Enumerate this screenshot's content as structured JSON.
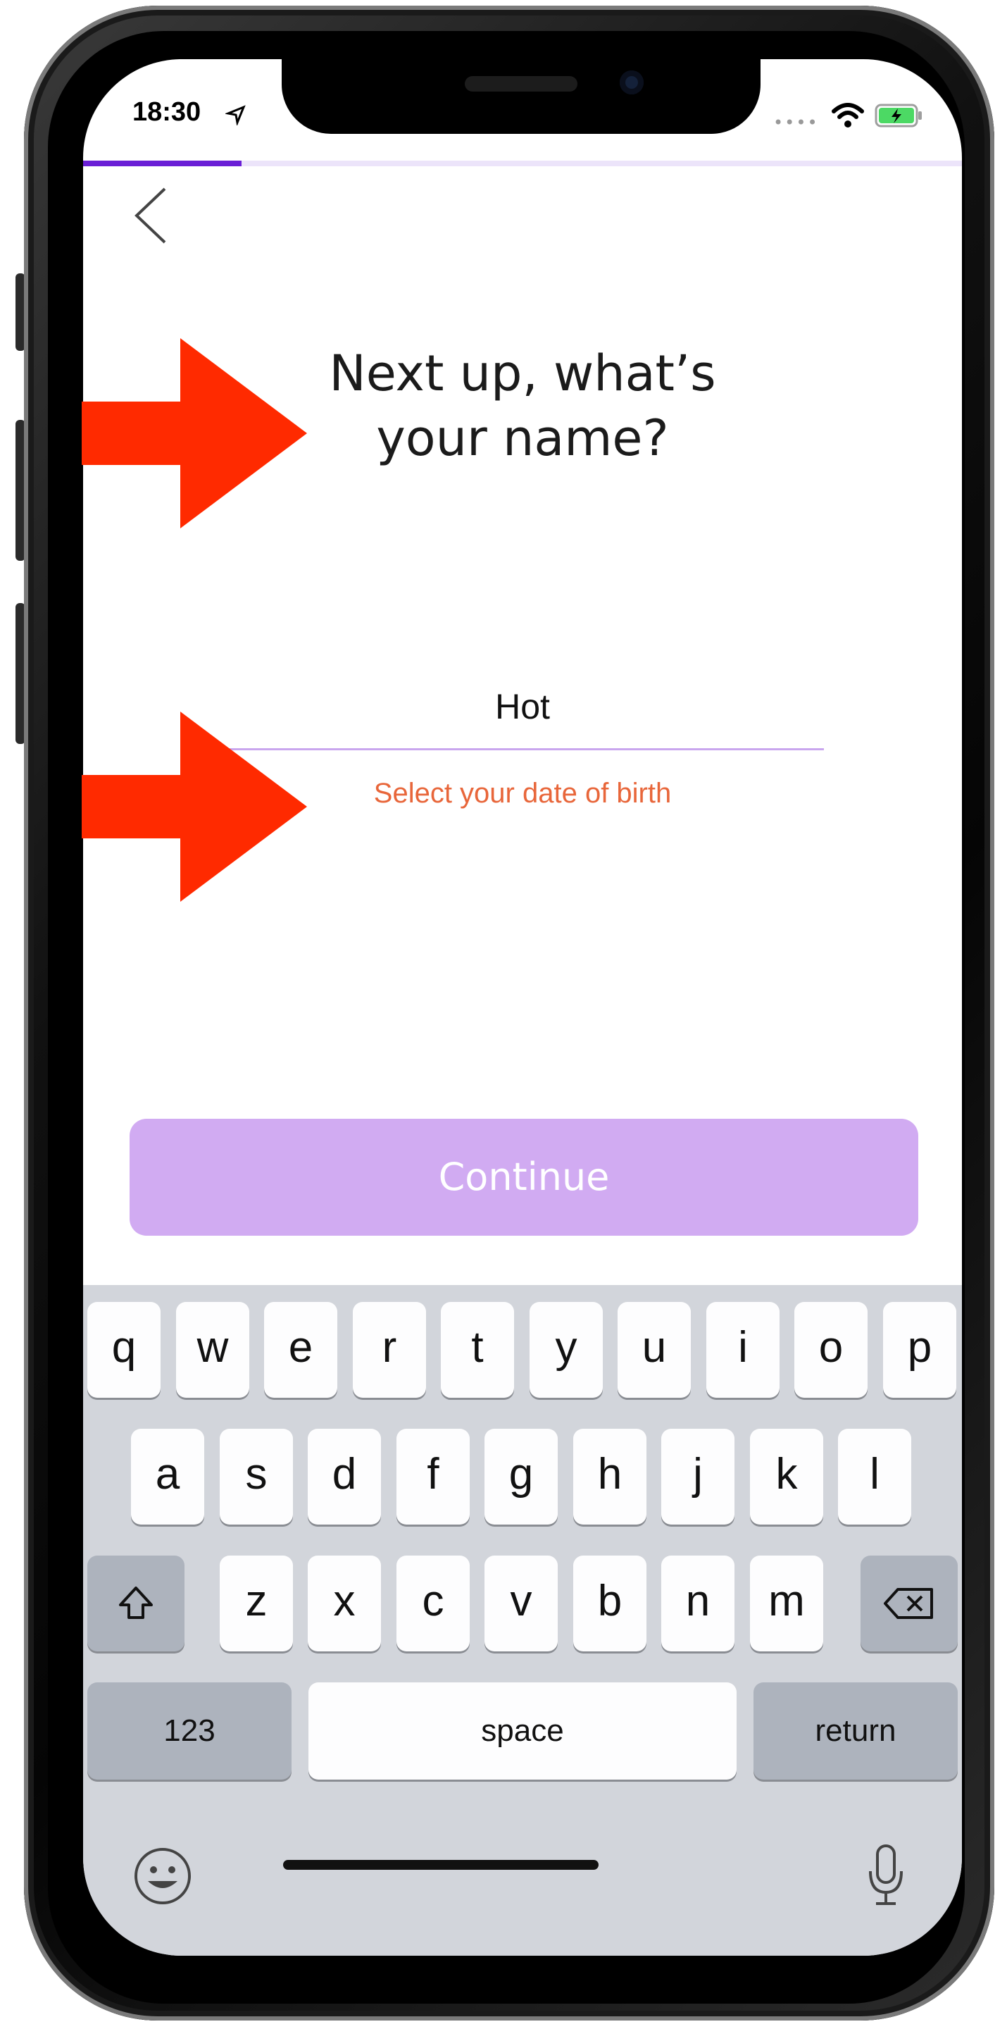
{
  "status_bar": {
    "time": "18:30"
  },
  "onboarding": {
    "progress": 0.18,
    "heading_line1": "Next up, what’s",
    "heading_line2": "your name?",
    "name_value": "Hot",
    "error_message": "Select your date of birth",
    "continue_label": "Continue"
  },
  "keyboard": {
    "row1": [
      "q",
      "w",
      "e",
      "r",
      "t",
      "y",
      "u",
      "i",
      "o",
      "p"
    ],
    "row2": [
      "a",
      "s",
      "d",
      "f",
      "g",
      "h",
      "j",
      "k",
      "l"
    ],
    "row3": [
      "z",
      "x",
      "c",
      "v",
      "b",
      "n",
      "m"
    ],
    "numbers_label": "123",
    "space_label": "space",
    "return_label": "return"
  },
  "icons": [
    "location-arrow-icon",
    "wifi-icon",
    "battery-charging-icon",
    "back-chevron-icon",
    "shift-icon",
    "backspace-icon",
    "emoji-icon",
    "microphone-icon",
    "red-arrow-annotation"
  ],
  "colors": {
    "accent": "#6a1fd6",
    "continue_disabled": "#d1abf2",
    "error": "#e8663a",
    "annotation": "#ff2a00"
  }
}
